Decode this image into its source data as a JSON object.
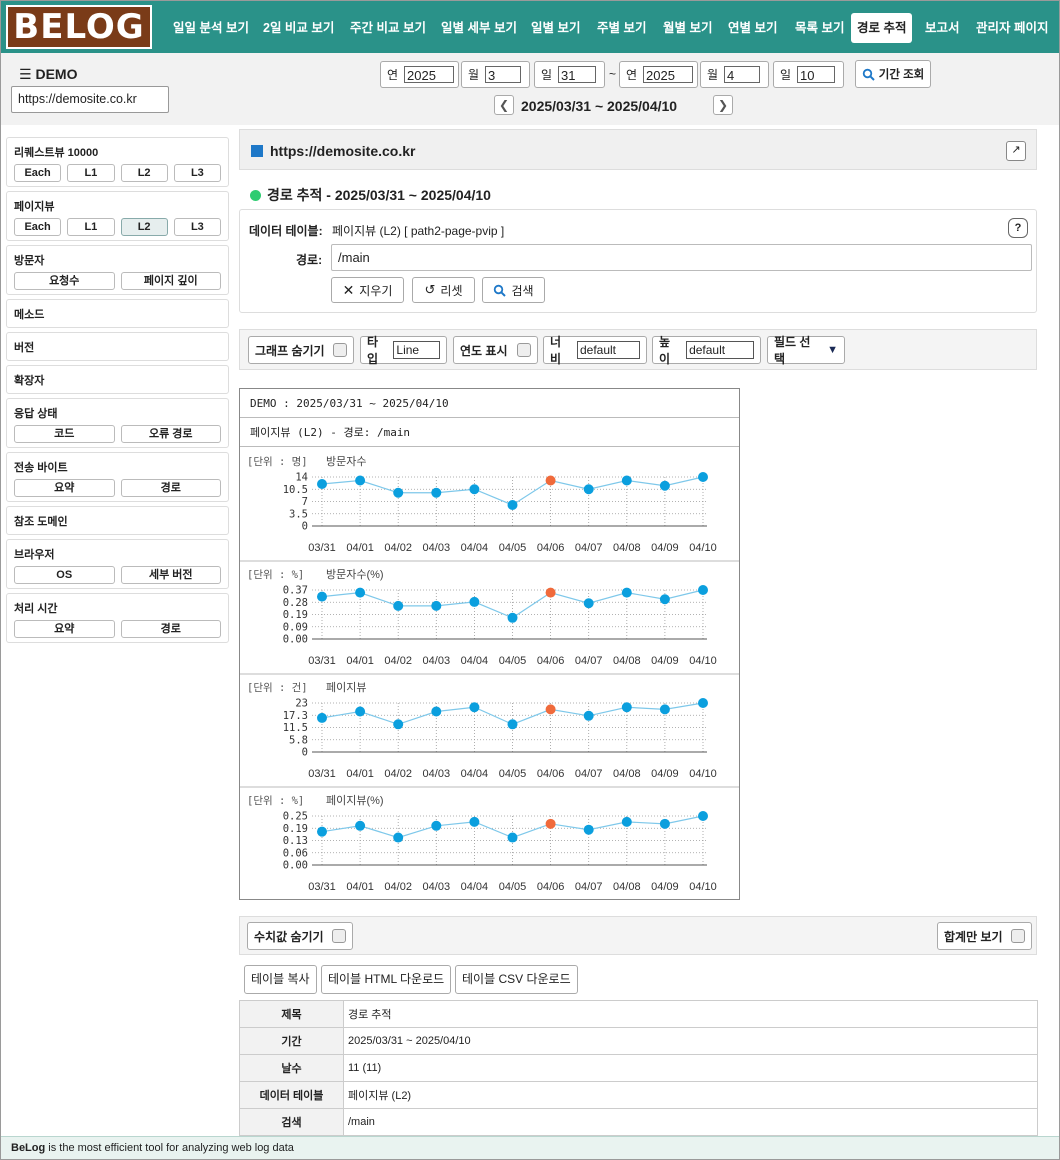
{
  "logo": "BELOG",
  "nav": [
    "일일 분석 보기",
    "2일 비교 보기",
    "주간 비교 보기",
    "일별 세부 보기",
    "일별 보기",
    "주별 보기",
    "월별 보기",
    "연별 보기",
    "목록 보기",
    "경로 추적",
    "보고서",
    "관리자 페이지"
  ],
  "nav_active": "경로 추적",
  "header": {
    "site_title": "DEMO",
    "site_url": "https://demosite.co.kr",
    "year_label": "연",
    "month_label": "월",
    "day_label": "일",
    "from": {
      "year": "2025",
      "month": "3",
      "day": "31"
    },
    "to": {
      "year": "2025",
      "month": "4",
      "day": "10"
    },
    "tilde": "~",
    "period_button": "기간 조회",
    "range": "2025/03/31 ~ 2025/04/10"
  },
  "sidebar": [
    {
      "title": "리퀘스트뷰 10000",
      "buttons": [
        "Each",
        "L1",
        "L2",
        "L3"
      ],
      "active": ""
    },
    {
      "title": "페이지뷰",
      "buttons": [
        "Each",
        "L1",
        "L2",
        "L3"
      ],
      "active": "L2"
    },
    {
      "title": "방문자",
      "buttons": [
        "요청수",
        "페이지 깊이"
      ],
      "active": ""
    },
    {
      "title": "메소드",
      "buttons": []
    },
    {
      "title": "버전",
      "buttons": []
    },
    {
      "title": "확장자",
      "buttons": []
    },
    {
      "title": "응답 상태",
      "buttons": [
        "코드",
        "오류 경로"
      ]
    },
    {
      "title": "전송 바이트",
      "buttons": [
        "요약",
        "경로"
      ]
    },
    {
      "title": "참조 도메인",
      "buttons": []
    },
    {
      "title": "브라우저",
      "buttons": [
        "OS",
        "세부 버전"
      ]
    },
    {
      "title": "처리 시간",
      "buttons": [
        "요약",
        "경로"
      ]
    }
  ],
  "main": {
    "site": "https://demosite.co.kr",
    "heading": "경로 추적 - 2025/03/31 ~ 2025/04/10",
    "data_table_label": "데이터 테이블:",
    "data_table_value": "페이지뷰 (L2)  [ path2-page-pvip ]",
    "help": "?",
    "path_label": "경로:",
    "path_value": "/main",
    "clear_btn": "지우기",
    "reset_btn": "리셋",
    "search_btn": "검색"
  },
  "options": {
    "hide_graph": "그래프 숨기기",
    "type_label": "타입",
    "type_value": "Line",
    "show_year": "연도 표시",
    "width_label": "너비",
    "width_value": "default",
    "height_label": "높이",
    "height_value": "default",
    "field_select": "필드 선택"
  },
  "chart_header": {
    "line1": "DEMO : 2025/03/31 ~ 2025/04/10",
    "line2": "페이지뷰 (L2) - 경로: /main"
  },
  "chart_data": [
    {
      "type": "line",
      "unit": "[단위 : 명]",
      "title": "방문자수",
      "categories": [
        "03/31",
        "04/01",
        "04/02",
        "04/03",
        "04/04",
        "04/05",
        "04/06",
        "04/07",
        "04/08",
        "04/09",
        "04/10"
      ],
      "values": [
        12,
        13,
        9.5,
        9.5,
        10.5,
        6,
        13,
        10.5,
        13,
        11.5,
        14
      ],
      "yticks": [
        "14",
        "10.5",
        "7",
        "3.5",
        "0"
      ],
      "ylim": [
        0,
        14
      ],
      "highlight_index": 6
    },
    {
      "type": "line",
      "unit": "[단위 : %]",
      "title": "방문자수(%)",
      "categories": [
        "03/31",
        "04/01",
        "04/02",
        "04/03",
        "04/04",
        "04/05",
        "04/06",
        "04/07",
        "04/08",
        "04/09",
        "04/10"
      ],
      "values": [
        0.32,
        0.35,
        0.25,
        0.25,
        0.28,
        0.16,
        0.35,
        0.27,
        0.35,
        0.3,
        0.37
      ],
      "yticks": [
        "0.37",
        "0.28",
        "0.19",
        "0.09",
        "0.00"
      ],
      "ylim": [
        0,
        0.37
      ],
      "highlight_index": 6
    },
    {
      "type": "line",
      "unit": "[단위 : 건]",
      "title": "페이지뷰",
      "categories": [
        "03/31",
        "04/01",
        "04/02",
        "04/03",
        "04/04",
        "04/05",
        "04/06",
        "04/07",
        "04/08",
        "04/09",
        "04/10"
      ],
      "values": [
        16,
        19,
        13,
        19,
        21,
        13,
        20,
        17,
        21,
        20,
        23
      ],
      "yticks": [
        "23",
        "17.3",
        "11.5",
        "5.8",
        "0"
      ],
      "ylim": [
        0,
        23
      ],
      "highlight_index": 6
    },
    {
      "type": "line",
      "unit": "[단위 : %]",
      "title": "페이지뷰(%)",
      "categories": [
        "03/31",
        "04/01",
        "04/02",
        "04/03",
        "04/04",
        "04/05",
        "04/06",
        "04/07",
        "04/08",
        "04/09",
        "04/10"
      ],
      "values": [
        0.17,
        0.2,
        0.14,
        0.2,
        0.22,
        0.14,
        0.21,
        0.18,
        0.22,
        0.21,
        0.25
      ],
      "yticks": [
        "0.25",
        "0.19",
        "0.13",
        "0.06",
        "0.00"
      ],
      "ylim": [
        0,
        0.25
      ],
      "highlight_index": 6
    }
  ],
  "table_options": {
    "hide_values": "수치값 숨기기",
    "total_only": "합계만 보기",
    "copy": "테이블 복사",
    "html_download": "테이블 HTML 다운로드",
    "csv_download": "테이블 CSV 다운로드"
  },
  "info_table": [
    {
      "label": "제목",
      "value": "경로 추적"
    },
    {
      "label": "기간",
      "value": "2025/03/31 ~ 2025/04/10"
    },
    {
      "label": "날수",
      "value": "11 (11)"
    },
    {
      "label": "데이터 테이블",
      "value": "페이지뷰 (L2)"
    },
    {
      "label": "검색",
      "value": "/main"
    }
  ],
  "footer": {
    "brand": "BeLog",
    "text": " is the most efficient tool for analyzing web log data"
  },
  "colors": {
    "nav": "#2a9289",
    "logo": "#7a3b18",
    "point": "#0b9fde",
    "highlight": "#f06a3b",
    "line": "#7ec8ea"
  }
}
